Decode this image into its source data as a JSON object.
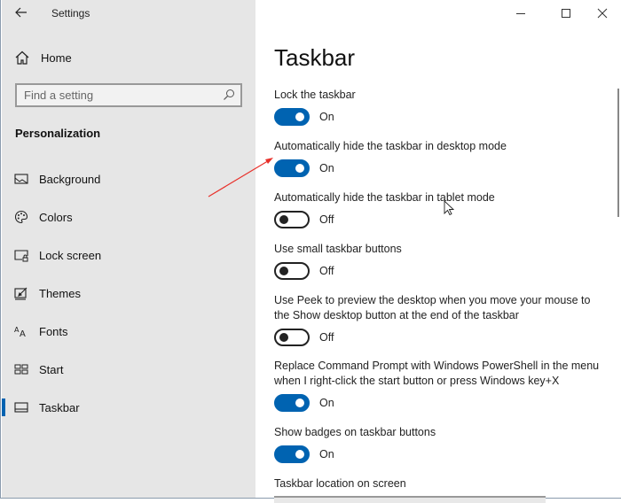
{
  "window": {
    "title": "Settings",
    "controls": {
      "minimize": "minimize",
      "maximize": "maximize",
      "close": "close"
    }
  },
  "sidebar": {
    "home_label": "Home",
    "search": {
      "placeholder": "Find a setting",
      "value": ""
    },
    "section_heading": "Personalization",
    "items": [
      {
        "label": "Background",
        "icon": "image-icon",
        "selected": false
      },
      {
        "label": "Colors",
        "icon": "palette-icon",
        "selected": false
      },
      {
        "label": "Lock screen",
        "icon": "lock-screen-icon",
        "selected": false
      },
      {
        "label": "Themes",
        "icon": "themes-icon",
        "selected": false
      },
      {
        "label": "Fonts",
        "icon": "fonts-icon",
        "selected": false
      },
      {
        "label": "Start",
        "icon": "start-icon",
        "selected": false
      },
      {
        "label": "Taskbar",
        "icon": "taskbar-icon",
        "selected": true
      }
    ]
  },
  "main": {
    "title": "Taskbar",
    "settings": [
      {
        "label": "Lock the taskbar",
        "state": "On",
        "on": true
      },
      {
        "label": "Automatically hide the taskbar in desktop mode",
        "state": "On",
        "on": true
      },
      {
        "label": "Automatically hide the taskbar in tablet mode",
        "state": "Off",
        "on": false
      },
      {
        "label": "Use small taskbar buttons",
        "state": "Off",
        "on": false
      },
      {
        "label": "Use Peek to preview the desktop when you move your mouse to the Show desktop button at the end of the taskbar",
        "state": "Off",
        "on": false
      },
      {
        "label": "Replace Command Prompt with Windows PowerShell in the menu when I right-click the start button or press Windows key+X",
        "state": "On",
        "on": true
      },
      {
        "label": "Show badges on taskbar buttons",
        "state": "On",
        "on": true
      }
    ],
    "location_label": "Taskbar location on screen"
  },
  "colors": {
    "accent": "#0063b1",
    "sidebar_bg": "#e6e6e6",
    "annotation_arrow": "#e8302a"
  }
}
